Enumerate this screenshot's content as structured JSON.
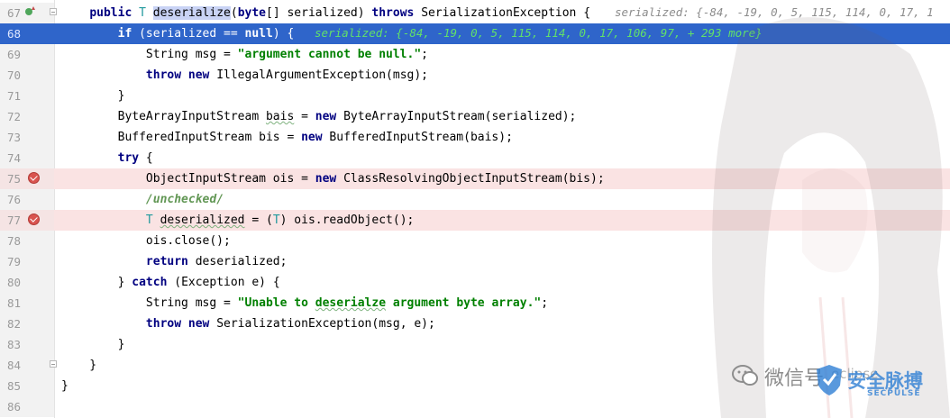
{
  "editor": {
    "lines": [
      {
        "num": "67",
        "tokens": [
          [
            "",
            "    "
          ],
          [
            "kw",
            "public"
          ],
          [
            "",
            " "
          ],
          [
            "tp",
            "T"
          ],
          [
            "",
            " "
          ],
          [
            "hl",
            "deserialize"
          ],
          [
            "",
            "("
          ],
          [
            "kw",
            "byte"
          ],
          [
            "",
            "[] serialized) "
          ],
          [
            "kw",
            "throws"
          ],
          [
            "",
            " SerializationException {"
          ]
        ],
        "hint": "serialized: {-84, -19, 0, 5, 115, 114, 0, 17, 1"
      },
      {
        "num": "68",
        "tokens": [
          [
            "",
            "        "
          ],
          [
            "kw",
            "if"
          ],
          [
            "",
            " (serialized == "
          ],
          [
            "kw",
            "null"
          ],
          [
            "",
            ") {"
          ]
        ],
        "hint": "serialized: {-84, -19, 0, 5, 115, 114, 0, 17, 106, 97, + 293 more}"
      },
      {
        "num": "69",
        "tokens": [
          [
            "",
            "            String msg = "
          ],
          [
            "str",
            "\"argument cannot be null.\""
          ],
          [
            "",
            ";"
          ]
        ]
      },
      {
        "num": "70",
        "tokens": [
          [
            "",
            "            "
          ],
          [
            "kw",
            "throw"
          ],
          [
            "",
            " "
          ],
          [
            "kw",
            "new"
          ],
          [
            "",
            " IllegalArgumentException(msg);"
          ]
        ]
      },
      {
        "num": "71",
        "tokens": [
          [
            "",
            "        }"
          ]
        ]
      },
      {
        "num": "72",
        "tokens": [
          [
            "",
            "        ByteArrayInputStream "
          ],
          [
            "wavy",
            "bais"
          ],
          [
            "",
            " = "
          ],
          [
            "kw",
            "new"
          ],
          [
            "",
            " ByteArrayInputStream(serialized);"
          ]
        ]
      },
      {
        "num": "73",
        "tokens": [
          [
            "",
            "        BufferedInputStream bis = "
          ],
          [
            "kw",
            "new"
          ],
          [
            "",
            " BufferedInputStream(bais);"
          ]
        ]
      },
      {
        "num": "74",
        "tokens": [
          [
            "",
            "        "
          ],
          [
            "kw",
            "try"
          ],
          [
            "",
            " {"
          ]
        ]
      },
      {
        "num": "75",
        "tokens": [
          [
            "",
            "            ObjectInputStream ois = "
          ],
          [
            "kw",
            "new"
          ],
          [
            "",
            " ClassResolvingObjectInputStream(bis);"
          ]
        ]
      },
      {
        "num": "76",
        "tokens": [
          [
            "",
            "            "
          ],
          [
            "cm",
            "/unchecked/"
          ]
        ]
      },
      {
        "num": "77",
        "tokens": [
          [
            "",
            "            "
          ],
          [
            "tp",
            "T"
          ],
          [
            "",
            " "
          ],
          [
            "wavy",
            "deserialized"
          ],
          [
            "",
            " = ("
          ],
          [
            "tp",
            "T"
          ],
          [
            "",
            ") ois.readObject();"
          ]
        ]
      },
      {
        "num": "78",
        "tokens": [
          [
            "",
            "            ois.close();"
          ]
        ]
      },
      {
        "num": "79",
        "tokens": [
          [
            "",
            "            "
          ],
          [
            "kw",
            "return"
          ],
          [
            "",
            " deserialized;"
          ]
        ]
      },
      {
        "num": "80",
        "tokens": [
          [
            "",
            "        } "
          ],
          [
            "kw",
            "catch"
          ],
          [
            "",
            " (Exception e) {"
          ]
        ]
      },
      {
        "num": "81",
        "tokens": [
          [
            "",
            "            String msg = "
          ],
          [
            "str",
            "\"Unable to "
          ],
          [
            "str wavy",
            "deserialze"
          ],
          [
            "str",
            " argument byte array.\""
          ],
          [
            "",
            ";"
          ]
        ]
      },
      {
        "num": "82",
        "tokens": [
          [
            "",
            "            "
          ],
          [
            "kw",
            "throw"
          ],
          [
            "",
            " "
          ],
          [
            "kw",
            "new"
          ],
          [
            "",
            " SerializationException(msg, e);"
          ]
        ]
      },
      {
        "num": "83",
        "tokens": [
          [
            "",
            "        }"
          ]
        ]
      },
      {
        "num": "84",
        "tokens": [
          [
            "",
            "    }"
          ]
        ]
      },
      {
        "num": "85",
        "tokens": [
          [
            "",
            "}"
          ]
        ]
      },
      {
        "num": "86",
        "tokens": []
      }
    ]
  },
  "watermark": {
    "wechat_label": "微信号",
    "account_text": "eclipse",
    "brand_cn": "安全脉搏",
    "brand_en": "SECPULSE"
  },
  "colors": {
    "exec_line": "#2f65ca",
    "breakpoint_line": "#fae3e3",
    "breakpoint_icon": "#d9534f"
  }
}
